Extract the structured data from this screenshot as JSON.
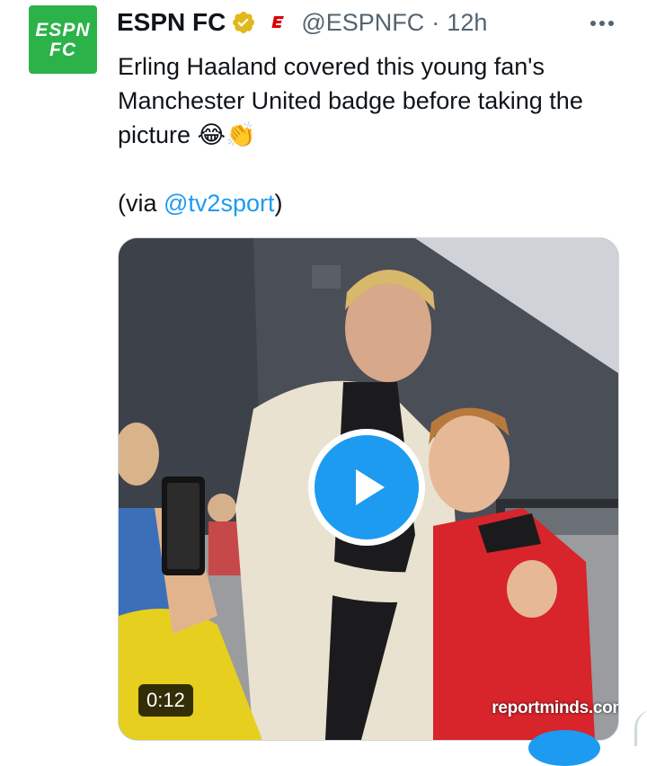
{
  "tweet": {
    "author": {
      "avatar_line1": "ESPN",
      "avatar_line2": "FC",
      "name": "ESPN FC",
      "handle": "@ESPNFC",
      "separator": "·",
      "time": "12h",
      "verified_icon": "gold-verified-badge-icon",
      "affiliate_icon": "espn-e-logo-icon"
    },
    "text_line1": "Erling Haaland covered this young fan's Manchester United badge before taking the picture 😂👏",
    "via_prefix": "(via ",
    "via_link": "@tv2sport",
    "via_suffix": ")",
    "media": {
      "duration": "0:12",
      "watermark": "reportminds.com",
      "play_icon": "play-icon"
    }
  },
  "colors": {
    "avatar_bg": "#2bb34a",
    "link": "#1d9bf0",
    "secondary_text": "#536471",
    "play_button": "#1d9bf0"
  }
}
